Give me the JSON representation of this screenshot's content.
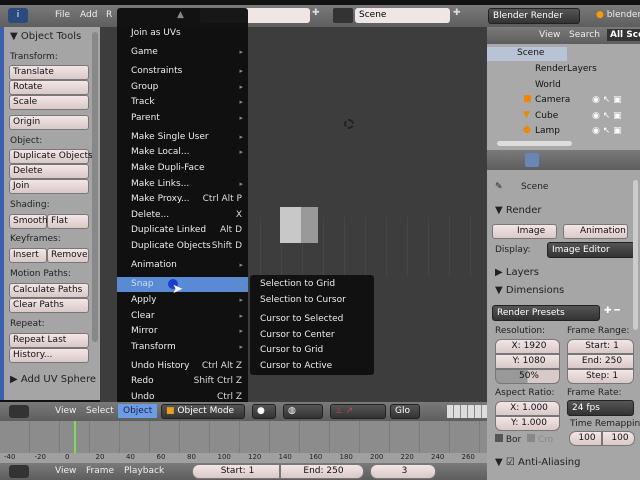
{
  "top_header": {
    "menus": [
      "File",
      "Add",
      "R"
    ],
    "scene": "Scene",
    "renderer": "Blender Render",
    "blender_label": "blender"
  },
  "tool_panel": {
    "title": "Object Tools",
    "transform_label": "Transform:",
    "translate": "Translate",
    "rotate": "Rotate",
    "scale": "Scale",
    "origin": "Origin",
    "object_label": "Object:",
    "duplicate_objects": "Duplicate Objects",
    "delete": "Delete",
    "join": "Join",
    "shading_label": "Shading:",
    "smooth": "Smooth",
    "flat": "Flat",
    "keyframes_label": "Keyframes:",
    "insert": "Insert",
    "remove": "Remove",
    "motion_paths_label": "Motion Paths:",
    "calculate_paths": "Calculate Paths",
    "clear_paths": "Clear Paths",
    "repeat_label": "Repeat:",
    "repeat_last": "Repeat Last",
    "history": "History...",
    "add_uv_sphere": "Add UV Sphere"
  },
  "object_menu": {
    "items": [
      {
        "label": "Join as UVs",
        "shortcut": "",
        "sub": false
      },
      {
        "label": "Game",
        "shortcut": "",
        "sub": true
      },
      {
        "label": "Constraints",
        "shortcut": "",
        "sub": true
      },
      {
        "label": "Group",
        "shortcut": "",
        "sub": true
      },
      {
        "label": "Track",
        "shortcut": "",
        "sub": true
      },
      {
        "label": "Parent",
        "shortcut": "",
        "sub": true
      },
      {
        "label": "Make Single User",
        "shortcut": "",
        "sub": true
      },
      {
        "label": "Make Local...",
        "shortcut": "",
        "sub": true
      },
      {
        "label": "Make Dupli-Face",
        "shortcut": "",
        "sub": false
      },
      {
        "label": "Make Links...",
        "shortcut": "",
        "sub": true
      },
      {
        "label": "Make Proxy...",
        "shortcut": "Ctrl Alt P",
        "sub": false
      },
      {
        "label": "Delete...",
        "shortcut": "X",
        "sub": false
      },
      {
        "label": "Duplicate Linked",
        "shortcut": "Alt D",
        "sub": false
      },
      {
        "label": "Duplicate Objects",
        "shortcut": "Shift D",
        "sub": false
      },
      {
        "label": "Animation",
        "shortcut": "",
        "sub": true
      },
      {
        "label": "Snap",
        "shortcut": "",
        "sub": true
      },
      {
        "label": "Apply",
        "shortcut": "",
        "sub": true
      },
      {
        "label": "Clear",
        "shortcut": "",
        "sub": true
      },
      {
        "label": "Mirror",
        "shortcut": "",
        "sub": true
      },
      {
        "label": "Transform",
        "shortcut": "",
        "sub": true
      },
      {
        "label": "Undo History",
        "shortcut": "Ctrl Alt Z",
        "sub": false
      },
      {
        "label": "Redo",
        "shortcut": "Shift Ctrl Z",
        "sub": false
      },
      {
        "label": "Undo",
        "shortcut": "Ctrl Z",
        "sub": false
      }
    ],
    "highlighted": "Snap"
  },
  "snap_submenu": [
    "Selection to Grid",
    "Selection to Cursor",
    "Cursor to Selected",
    "Cursor to Center",
    "Cursor to Grid",
    "Cursor to Active"
  ],
  "outliner": {
    "view": "View",
    "search": "Search",
    "filter": "All Scenes",
    "items": [
      "Scene",
      "RenderLayers",
      "World",
      "Camera",
      "Cube",
      "Lamp"
    ]
  },
  "properties": {
    "scene": "Scene",
    "render": "Render",
    "image": "Image",
    "animation": "Animation",
    "display_label": "Display:",
    "display": "Image Editor",
    "layers": "Layers",
    "dimensions": "Dimensions",
    "render_presets": "Render Presets",
    "resolution_label": "Resolution:",
    "res_x": "X: 1920",
    "res_y": "Y: 1080",
    "res_pct": "50%",
    "frame_range_label": "Frame Range:",
    "start": "Start: 1",
    "end": "End: 250",
    "step": "Step: 1",
    "aspect_label": "Aspect Ratio:",
    "aspect_x": "X: 1.000",
    "aspect_y": "Y: 1.000",
    "frame_rate_label": "Frame Rate:",
    "fps": "24 fps",
    "time_remap_label": "Time Remappin",
    "remap_old": "100",
    "remap_new": "100",
    "border": "Bor",
    "crop": "Cro",
    "anti_aliasing": "Anti-Aliasing"
  },
  "view3d_header": {
    "view": "View",
    "select": "Select",
    "object": "Object",
    "mode": "Object Mode",
    "orientation": "Glo"
  },
  "timeline": {
    "ticks": [
      "-40",
      "-20",
      "0",
      "20",
      "40",
      "60",
      "80",
      "100",
      "120",
      "140",
      "160",
      "180",
      "200",
      "220",
      "240",
      "260"
    ],
    "view": "View",
    "frame": "Frame",
    "playback": "Playback",
    "start": "Start: 1",
    "end": "End: 250",
    "current": "3"
  }
}
